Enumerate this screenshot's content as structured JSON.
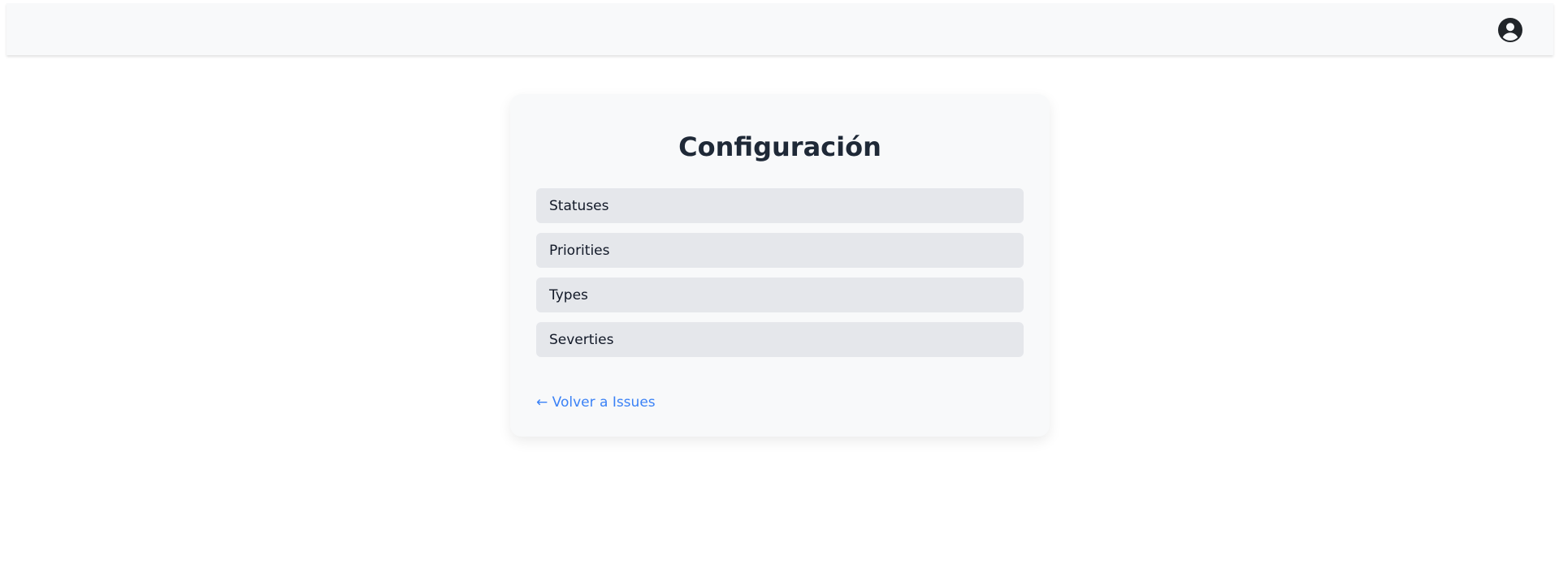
{
  "header": {
    "user_icon": "user-circle-icon"
  },
  "card": {
    "title": "Configuración",
    "items": [
      {
        "label": "Statuses"
      },
      {
        "label": "Priorities"
      },
      {
        "label": "Types"
      },
      {
        "label": "Severties"
      }
    ],
    "back_link": "← Volver a Issues"
  },
  "colors": {
    "link": "#3b82f6",
    "item_background": "#e5e7eb",
    "card_background": "#f8f9fa"
  }
}
